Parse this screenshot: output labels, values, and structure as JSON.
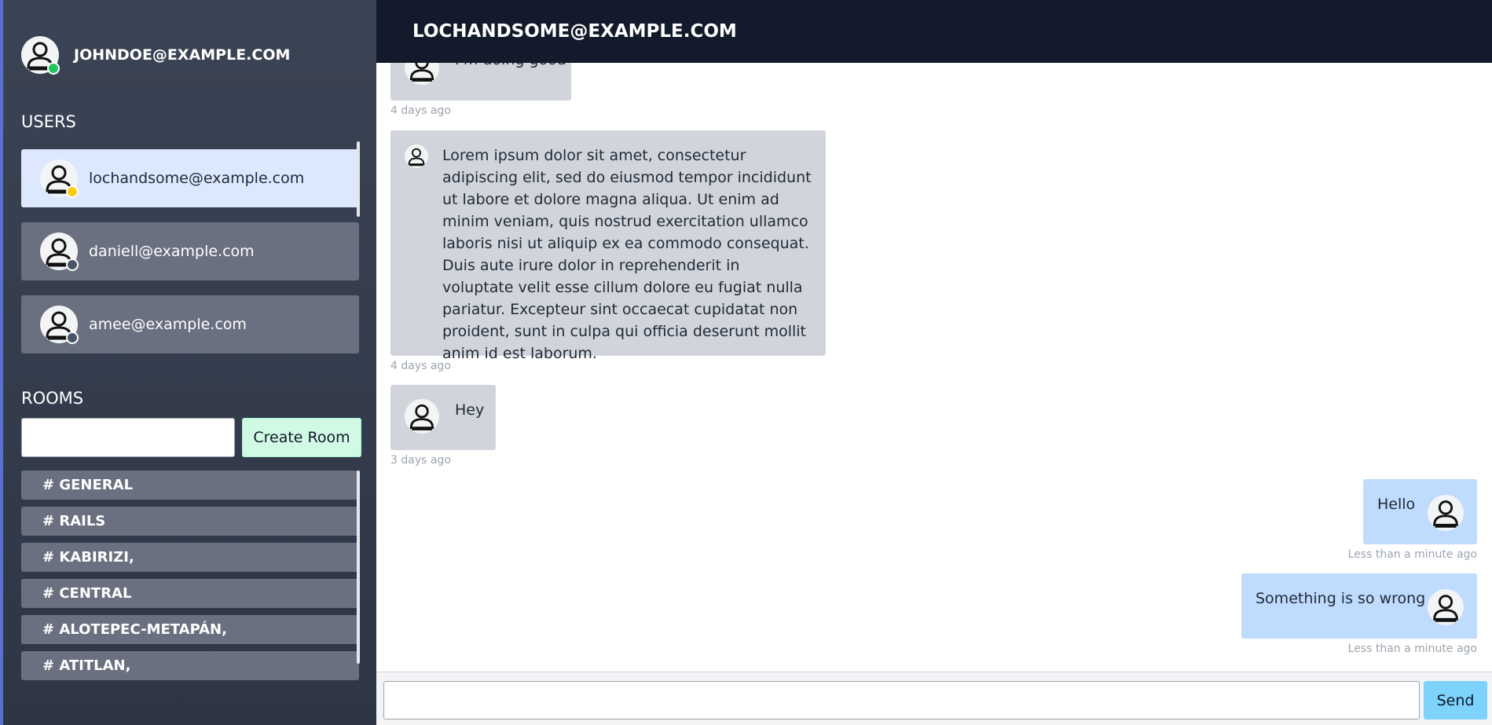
{
  "current_user": {
    "email": "JOHNDOE@EXAMPLE.COM",
    "status_color": "#22c55e",
    "icon": "user-icon"
  },
  "sidebar": {
    "users_title": "USERS",
    "users": [
      {
        "email": "lochandsome@example.com",
        "status_color": "#facc15",
        "active": true
      },
      {
        "email": "daniell@example.com",
        "status_color": "#475569",
        "active": false
      },
      {
        "email": "amee@example.com",
        "status_color": "#475569",
        "active": false
      }
    ],
    "rooms_title": "ROOMS",
    "room_input_value": "",
    "create_room_label": "Create Room",
    "rooms": [
      "# GENERAL",
      "# RAILS",
      "# KABIRIZI,",
      "# CENTRAL",
      "# ALOTEPEC-METAPÁN,",
      "# ATITLAN,"
    ]
  },
  "chat": {
    "title": "LOCHANDSOME@EXAMPLE.COM",
    "messages": [
      {
        "direction": "in",
        "text": "I'm doing good",
        "time": "4 days ago"
      },
      {
        "direction": "in",
        "text": "Lorem ipsum dolor sit amet, consectetur adipiscing elit, sed do eiusmod tempor incididunt ut labore et dolore magna aliqua. Ut enim ad minim veniam, quis nostrud exercitation ullamco laboris nisi ut aliquip ex ea commodo consequat. Duis aute irure dolor in reprehenderit in voluptate velit esse cillum dolore eu fugiat nulla pariatur. Excepteur sint occaecat cupidatat non proident, sunt in culpa qui officia deserunt mollit anim id est laborum.",
        "time": "4 days ago"
      },
      {
        "direction": "in",
        "text": "Hey",
        "time": "3 days ago"
      },
      {
        "direction": "out",
        "text": "Hello",
        "time": "Less than a minute ago"
      },
      {
        "direction": "out",
        "text": "Something is so wrong",
        "time": "Less than a minute ago"
      }
    ]
  },
  "composer": {
    "input_value": "",
    "send_label": "Send"
  },
  "colors": {
    "sidebar_bg": "#343c4c",
    "topbar_bg": "#121a2b",
    "incoming_bubble": "#d1d5db",
    "outgoing_bubble": "#bfdbfe",
    "active_user_bg": "#dbe8fd",
    "create_button_bg": "#d1fae5",
    "send_button_bg": "#7dd3fc"
  }
}
